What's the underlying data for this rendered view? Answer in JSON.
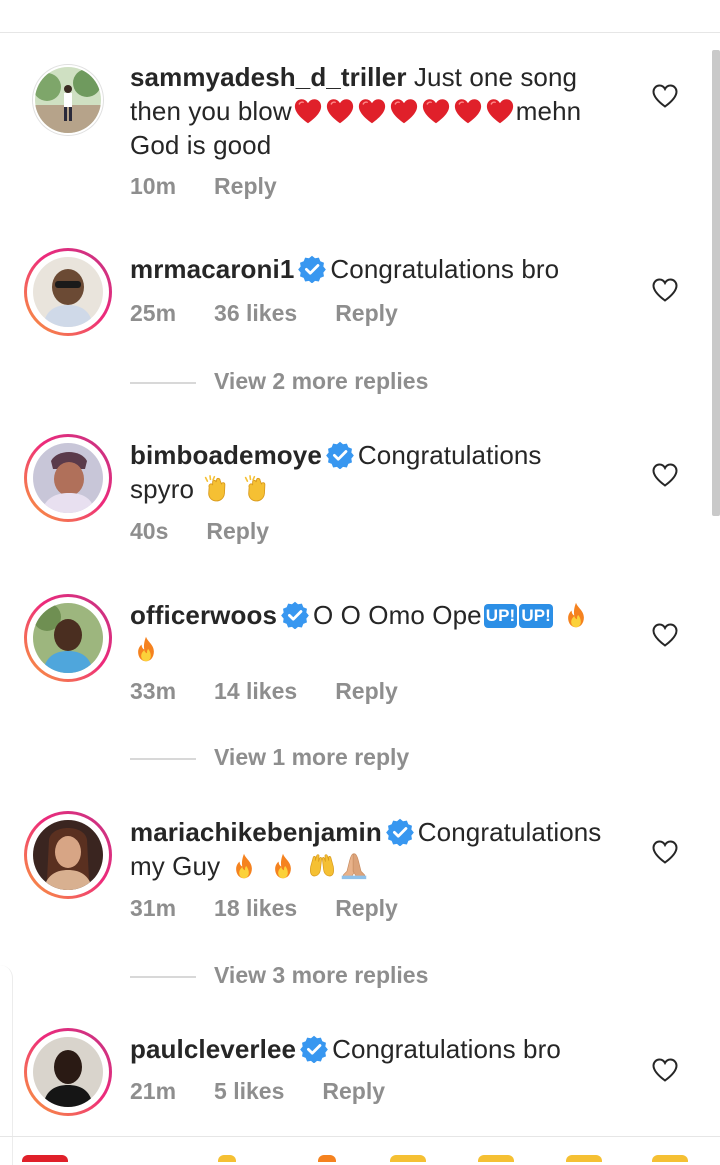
{
  "comments": [
    {
      "username": "sammyadesh_d_triller",
      "verified": false,
      "text_line1": "Just one song",
      "text_line2a": "then you blow",
      "text_line2b": "mehn",
      "text_line3": "God is good",
      "emoji_count": 7,
      "emoji": "red-heart",
      "time": "10m",
      "likes": "",
      "reply": "Reply"
    },
    {
      "username": "mrmacaroni1",
      "verified": true,
      "text": "Congratulations bro",
      "time": "25m",
      "likes": "36 likes",
      "reply": "Reply",
      "view_replies": "View 2 more replies"
    },
    {
      "username": "bimboademoye",
      "verified": true,
      "text_line1": "Congratulations",
      "text_line2": "spyro",
      "emoji": [
        "clapping-hands",
        "clapping-hands"
      ],
      "time": "40s",
      "likes": "",
      "reply": "Reply"
    },
    {
      "username": "officerwoos",
      "verified": true,
      "text": "O O Omo Ope",
      "up_badge": "UP!",
      "emoji": [
        "up-button",
        "up-button",
        "fire",
        "fire"
      ],
      "time": "33m",
      "likes": "14 likes",
      "reply": "Reply",
      "view_replies": "View 1 more reply"
    },
    {
      "username": "mariachikebenjamin",
      "verified": true,
      "text_line1": "Congratulations",
      "text_line2": "my Guy",
      "emoji": [
        "fire",
        "fire",
        "raising-hands",
        "folded-hands"
      ],
      "time": "31m",
      "likes": "18 likes",
      "reply": "Reply",
      "view_replies": "View 3 more replies"
    },
    {
      "username": "paulcleverlee",
      "verified": true,
      "text": "Congratulations bro",
      "time": "21m",
      "likes": "5 likes",
      "reply": "Reply"
    }
  ],
  "colors": {
    "verified_blue": "#3897f0",
    "heart_red": "#e0202a",
    "meta_gray": "#8e8e8e",
    "text": "#262626",
    "story_ring": "#ee2a7b"
  },
  "icons": [
    "like-heart-outline-icon",
    "verified-badge-icon"
  ]
}
